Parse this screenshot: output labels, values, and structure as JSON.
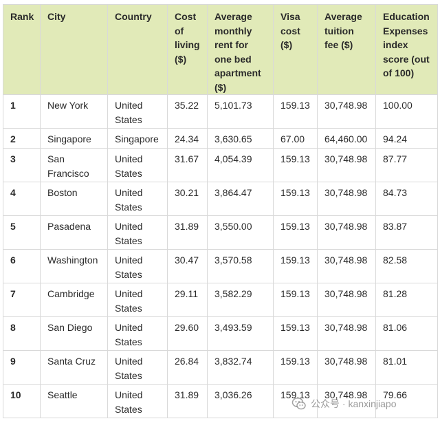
{
  "headers": {
    "rank": "Rank",
    "city": "City",
    "country": "Country",
    "cost_of_living": "Cost of living ($)",
    "rent": "Average monthly rent for one bed apartment ($)",
    "visa": "Visa cost ($)",
    "tuition": "Average tuition fee ($)",
    "education_index": "Education Expenses index score (out of 100)"
  },
  "rows": [
    {
      "rank": "1",
      "city": "New York",
      "country": "United States",
      "cost": "35.22",
      "rent": "5,101.73",
      "visa": "159.13",
      "tuition": "30,748.98",
      "score": "100.00"
    },
    {
      "rank": "2",
      "city": "Singapore",
      "country": "Singapore",
      "cost": "24.34",
      "rent": "3,630.65",
      "visa": "67.00",
      "tuition": "64,460.00",
      "score": "94.24"
    },
    {
      "rank": "3",
      "city": "San Francisco",
      "country": "United States",
      "cost": "31.67",
      "rent": "4,054.39",
      "visa": "159.13",
      "tuition": "30,748.98",
      "score": "87.77"
    },
    {
      "rank": "4",
      "city": "Boston",
      "country": "United States",
      "cost": "30.21",
      "rent": "3,864.47",
      "visa": "159.13",
      "tuition": "30,748.98",
      "score": "84.73"
    },
    {
      "rank": "5",
      "city": "Pasadena",
      "country": "United States",
      "cost": "31.89",
      "rent": "3,550.00",
      "visa": "159.13",
      "tuition": "30,748.98",
      "score": "83.87"
    },
    {
      "rank": "6",
      "city": "Washington",
      "country": "United States",
      "cost": "30.47",
      "rent": "3,570.58",
      "visa": "159.13",
      "tuition": "30,748.98",
      "score": "82.58"
    },
    {
      "rank": "7",
      "city": "Cambridge",
      "country": "United States",
      "cost": "29.11",
      "rent": "3,582.29",
      "visa": "159.13",
      "tuition": "30,748.98",
      "score": "81.28"
    },
    {
      "rank": "8",
      "city": "San Diego",
      "country": "United States",
      "cost": "29.60",
      "rent": "3,493.59",
      "visa": "159.13",
      "tuition": "30,748.98",
      "score": "81.06"
    },
    {
      "rank": "9",
      "city": "Santa Cruz",
      "country": "United States",
      "cost": "26.84",
      "rent": "3,832.74",
      "visa": "159.13",
      "tuition": "30,748.98",
      "score": "81.01"
    },
    {
      "rank": "10",
      "city": "Seattle",
      "country": "United States",
      "cost": "31.89",
      "rent": "3,036.26",
      "visa": "159.13",
      "tuition": "30,748.98",
      "score": "79.66"
    }
  ],
  "watermark": {
    "text": "公众号 · kanxinjiapo",
    "icon": "wechat-icon"
  }
}
